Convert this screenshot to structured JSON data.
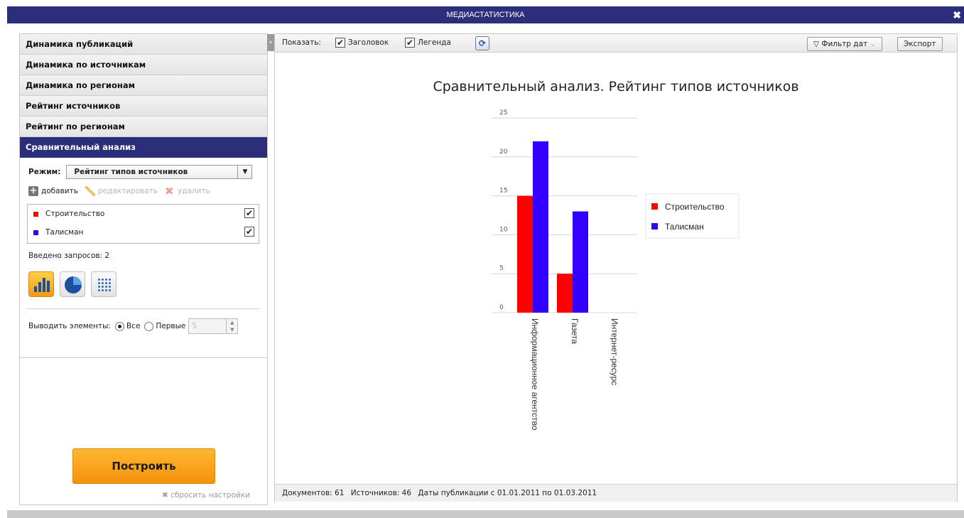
{
  "window": {
    "title": "МЕДИАСТАТИСТИКА",
    "close": "✖"
  },
  "sidebar": {
    "items": [
      {
        "label": "Динамика публикаций"
      },
      {
        "label": "Динамика по источникам"
      },
      {
        "label": "Динамика по регионам"
      },
      {
        "label": "Рейтинг источников"
      },
      {
        "label": "Рейтинг по регионам"
      },
      {
        "label": "Сравнительный анализ",
        "active": true
      }
    ],
    "mode_label": "Режим:",
    "mode_value": "Рейтинг типов источников",
    "actions": {
      "add": "добавить",
      "edit": "редактировать",
      "delete": "удалить"
    },
    "queries": [
      {
        "name": "Строительство",
        "color": "#ff0000",
        "checked": true
      },
      {
        "name": "Талисман",
        "color": "#3300ff",
        "checked": true
      }
    ],
    "queries_count": "Введено запросов: 2",
    "output_label": "Выводить элементы:",
    "output_all": "Все",
    "output_first": "Первые",
    "output_first_value": "5",
    "build_button": "Построить",
    "reset": "сбросить настройки"
  },
  "toolbar": {
    "show_label": "Показать:",
    "title_cb": "Заголовок",
    "legend_cb": "Легенда",
    "date_filter": "Фильтр дат",
    "export": "Экспорт"
  },
  "chart_data": {
    "type": "bar",
    "title": "Сравнительный анализ. Рейтинг типов источников",
    "categories": [
      "Информационное агентство",
      "Газета",
      "Интернет-ресурс"
    ],
    "series": [
      {
        "name": "Строительство",
        "color": "#ff0000",
        "values": [
          15,
          5,
          0
        ]
      },
      {
        "name": "Талисман",
        "color": "#3300ff",
        "values": [
          22,
          13,
          0
        ]
      }
    ],
    "ylim": [
      0,
      25
    ],
    "yticks": [
      0,
      5,
      10,
      15,
      20,
      25
    ],
    "grid": true,
    "legend": "right"
  },
  "status": {
    "documents": "Документов: 61",
    "sources": "Источников: 46",
    "dates": "Даты публикации с 01.01.2011 по 01.03.2011"
  }
}
